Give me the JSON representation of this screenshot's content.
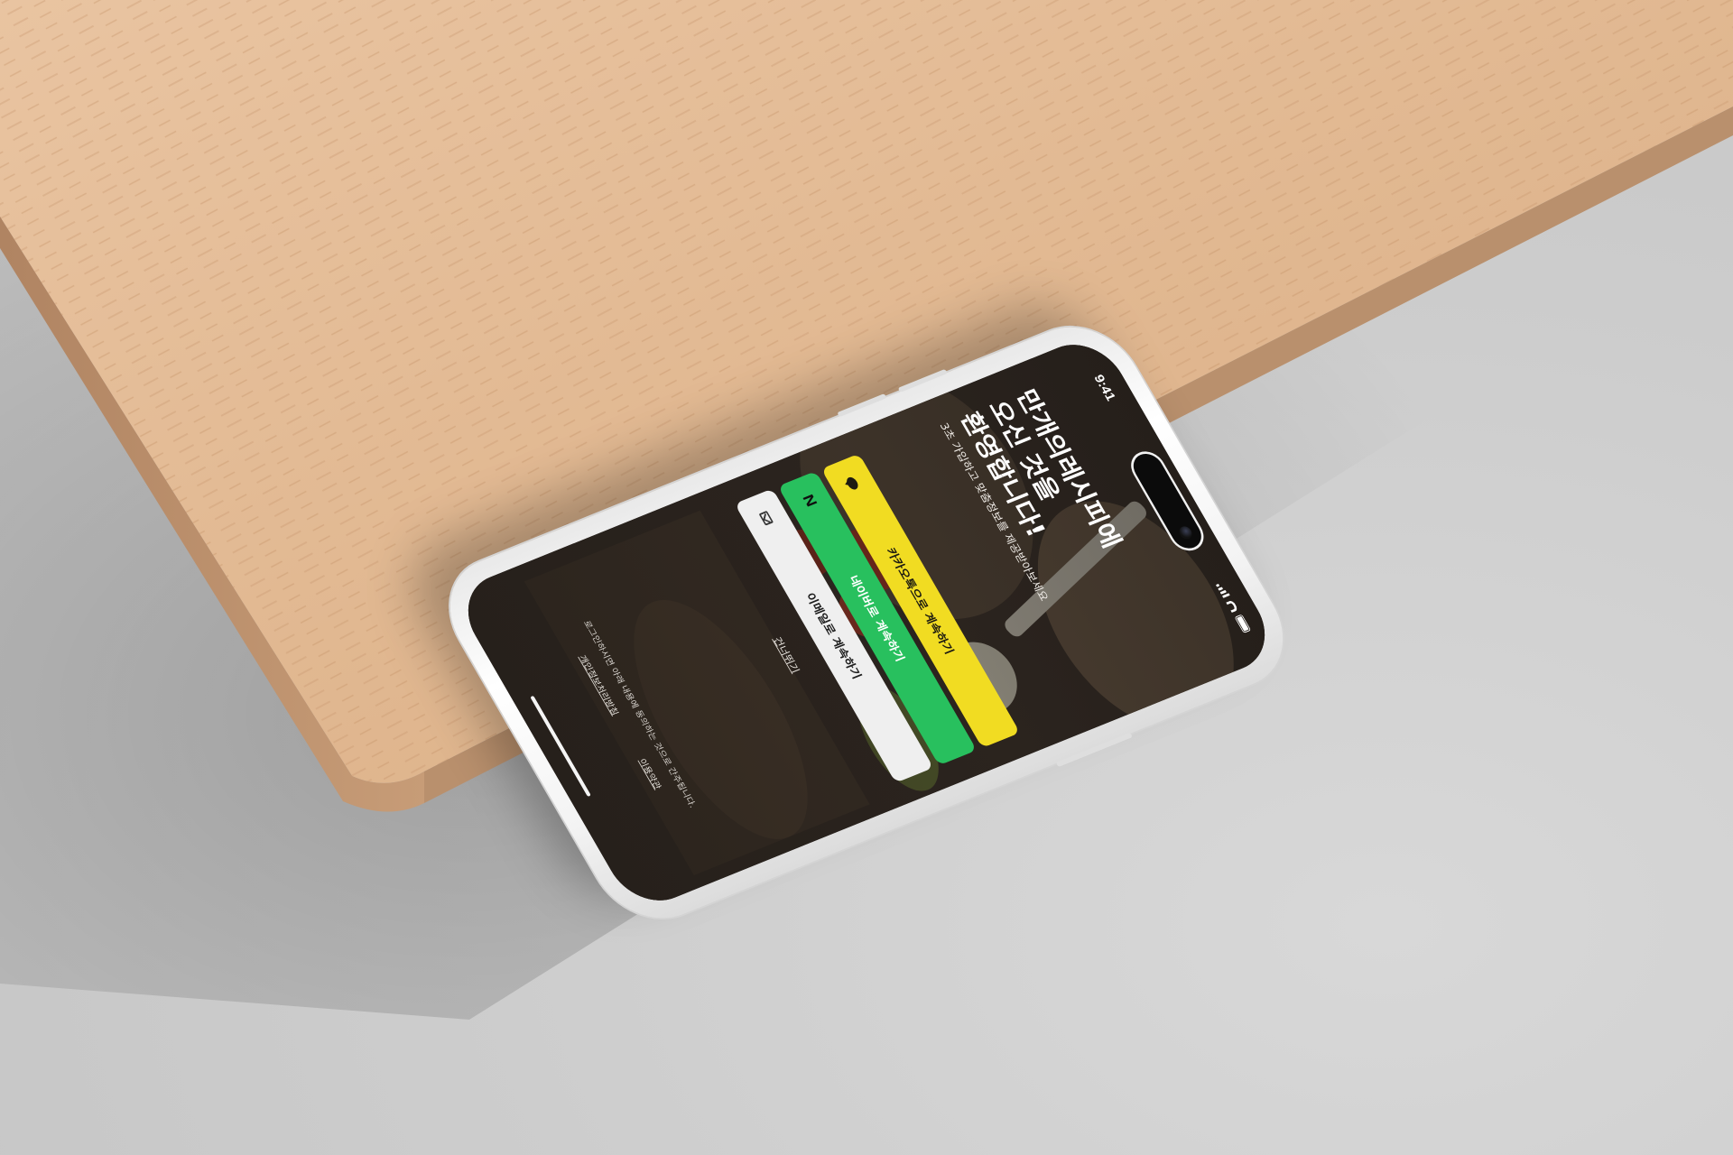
{
  "status_bar": {
    "time": "9:41",
    "signal_icon": "cellular-signal-icon",
    "wifi_icon": "wifi-icon",
    "battery_icon": "battery-icon"
  },
  "welcome": {
    "title_line1": "만개의레시피에",
    "title_line2": "오신 것을",
    "title_line3": "환영합니다!",
    "subtitle": "3초 가입하고 맞춤정보를 제공받아보세요"
  },
  "buttons": {
    "kakao": {
      "label": "카카오톡으로 계속하기",
      "icon": "kakao-bubble-icon",
      "color": "#f1dc22"
    },
    "naver": {
      "label": "네이버로 계속하기",
      "icon": "naver-n-icon",
      "color": "#28c05e"
    },
    "email": {
      "label": "이메일로 계속하기",
      "icon": "mail-icon",
      "color": "#efefef"
    }
  },
  "skip_label": "건너뛰기",
  "consent": {
    "text": "로그인하시면 아래 내용에 동의하는 것으로 간주됩니다.",
    "privacy_link": "개인정보처리방침",
    "terms_link": "이용약관"
  }
}
